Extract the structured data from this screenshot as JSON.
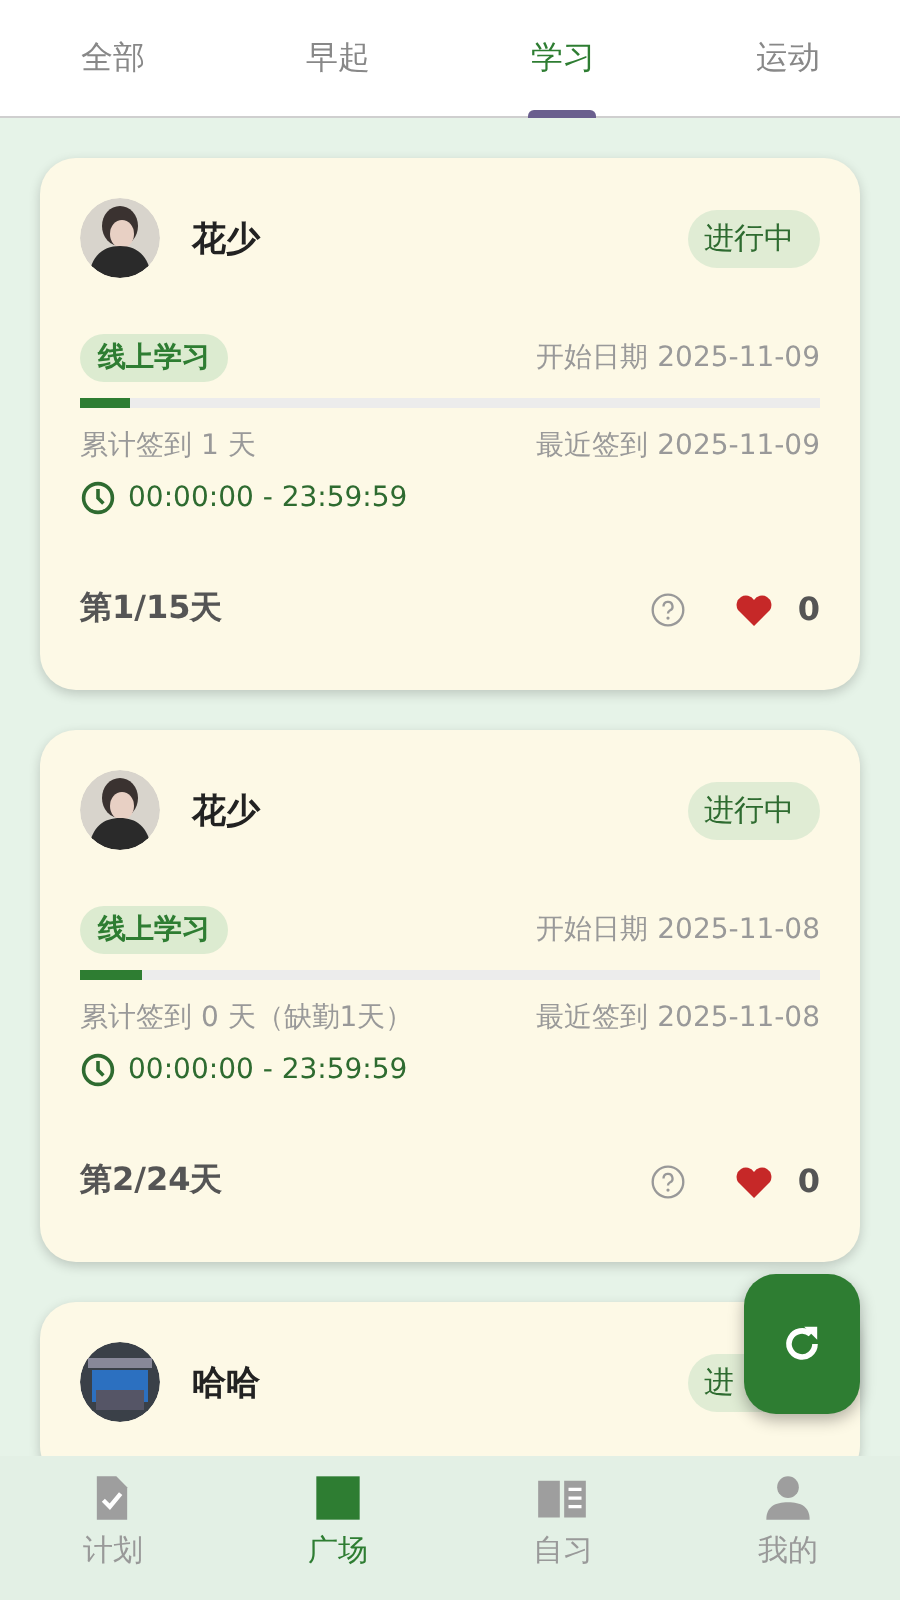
{
  "tabs": [
    {
      "label": "全部",
      "selected": false
    },
    {
      "label": "早起",
      "selected": false
    },
    {
      "label": "学习",
      "selected": true
    },
    {
      "label": "运动",
      "selected": false
    }
  ],
  "cards": [
    {
      "name": "花少",
      "status": "进行中",
      "category": "线上学习",
      "start_date": "开始日期 2025-11-09",
      "level": 0.067,
      "total_checkins": "累计签到 1 天",
      "last_checkin": "最近签到 2025-11-09",
      "time_range": "00:00:00 - 23:59:59",
      "day_progress": "第1/15天",
      "likes": "0"
    },
    {
      "name": "花少",
      "status": "进行中",
      "category": "线上学习",
      "start_date": "开始日期 2025-11-08",
      "level": 0.083,
      "total_checkins": "累计签到 0 天（缺勤1天）",
      "last_checkin": "最近签到 2025-11-08",
      "time_range": "00:00:00 - 23:59:59",
      "day_progress": "第2/24天",
      "likes": "0"
    },
    {
      "name": "哈哈",
      "status": "进"
    }
  ],
  "bottom_nav": [
    {
      "label": "计划",
      "kind": "plan",
      "selected": false
    },
    {
      "label": "广场",
      "kind": "square",
      "selected": true
    },
    {
      "label": "自习",
      "kind": "study",
      "selected": false
    },
    {
      "label": "我的",
      "kind": "me",
      "selected": false
    }
  ]
}
